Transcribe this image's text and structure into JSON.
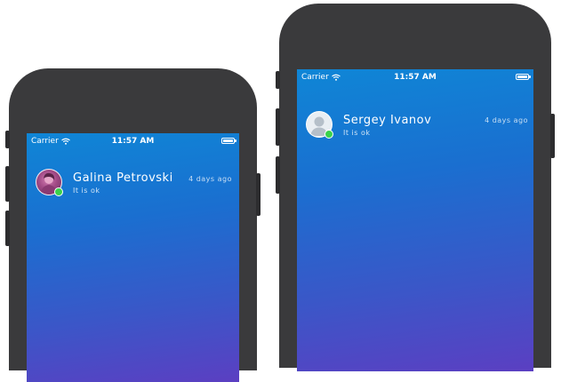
{
  "screens": [
    {
      "status": {
        "carrier": "Carrier",
        "time": "11:57 AM"
      },
      "contact": {
        "name": "Galina  Petrovski",
        "message": "It is ok",
        "time": "4 days ago",
        "avatar": "photo-avatar",
        "online": true
      }
    },
    {
      "status": {
        "carrier": "Carrier",
        "time": "11:57 AM"
      },
      "contact": {
        "name": "Sergey  Ivanov",
        "message": "It is ok",
        "time": "4 days ago",
        "avatar": "placeholder-avatar",
        "online": true
      }
    }
  ],
  "colors": {
    "gradient_top": "#0f86d6",
    "gradient_bottom": "#5b3fc2",
    "online": "#3ad24b",
    "phone_frame": "#3a3a3c"
  }
}
